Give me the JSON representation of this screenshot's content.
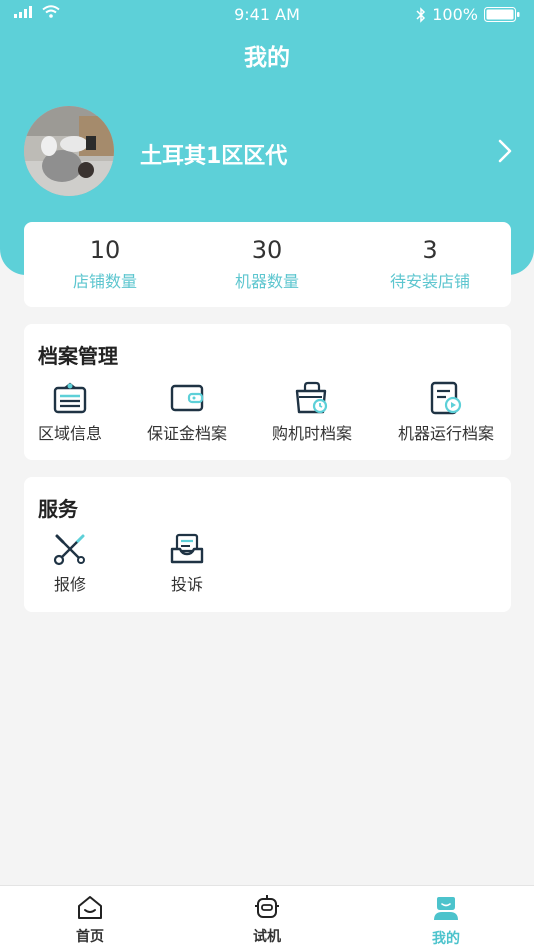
{
  "status_bar": {
    "time": "9:41 AM",
    "battery": "100%"
  },
  "header": {
    "title": "我的"
  },
  "profile": {
    "name": "土耳其1区区代"
  },
  "stats": [
    {
      "value": "10",
      "label": "店铺数量"
    },
    {
      "value": "30",
      "label": "机器数量"
    },
    {
      "value": "3",
      "label": "待安装店铺"
    }
  ],
  "archive": {
    "title": "档案管理",
    "items": [
      {
        "label": "区域信息",
        "icon": "region-info-icon"
      },
      {
        "label": "保证金档案",
        "icon": "wallet-icon"
      },
      {
        "label": "购机时档案",
        "icon": "purchase-bag-icon"
      },
      {
        "label": "机器运行档案",
        "icon": "machine-run-record-icon"
      }
    ]
  },
  "service": {
    "title": "服务",
    "items": [
      {
        "label": "报修",
        "icon": "repair-tools-icon"
      },
      {
        "label": "投诉",
        "icon": "complaint-inbox-icon"
      }
    ]
  },
  "tabbar": {
    "items": [
      {
        "label": "首页",
        "icon": "home-icon",
        "active": false
      },
      {
        "label": "试机",
        "icon": "robot-icon",
        "active": false
      },
      {
        "label": "我的",
        "icon": "user-icon",
        "active": true
      }
    ]
  },
  "colors": {
    "primary": "#5dd0d8",
    "accent_text": "#5dc6cf",
    "background": "#f4f4f4",
    "icon_dark": "#1f3344"
  }
}
